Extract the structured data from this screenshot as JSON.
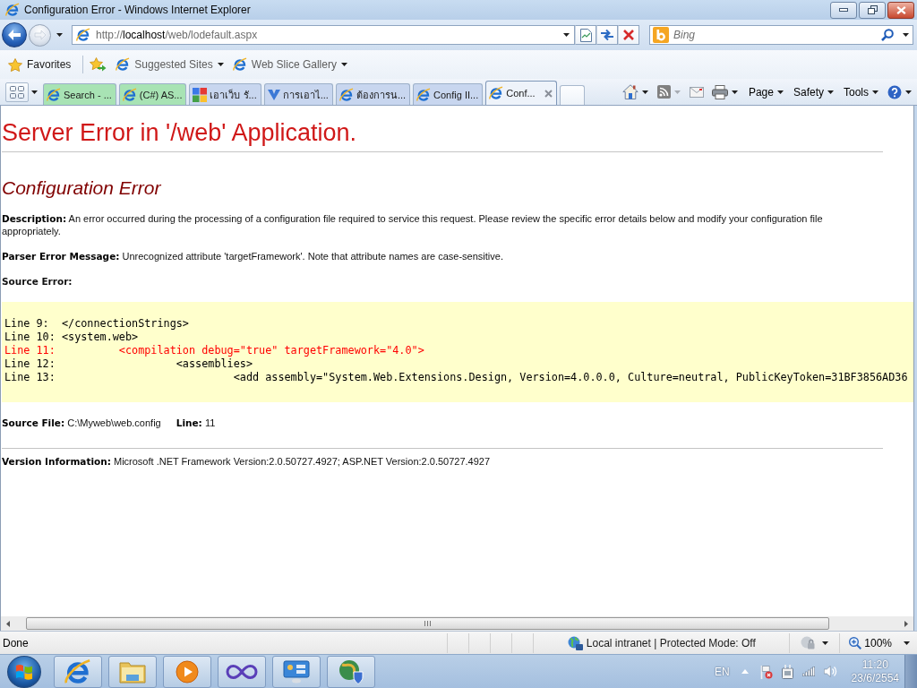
{
  "window": {
    "title": "Configuration Error - Windows Internet Explorer"
  },
  "nav_buttons": [
    {
      "kind": "back",
      "disabled": false
    },
    {
      "kind": "forward",
      "disabled": true
    }
  ],
  "address_bar": {
    "url": [
      {
        "text": "http://",
        "kind": "plain"
      },
      {
        "text": "localhost",
        "kind": "domain"
      },
      {
        "text": "/web/lodefault.aspx",
        "kind": "plain"
      }
    ]
  },
  "search_box": {
    "placeholder": "Bing"
  },
  "favorites_bar": {
    "favorites": "Favorites",
    "links": [
      {
        "label": "Suggested Sites"
      },
      {
        "label": "Web Slice Gallery"
      }
    ]
  },
  "tabs": [
    {
      "label": "Search - ...",
      "kind": "page",
      "selected": false,
      "color": "#a8e3b4"
    },
    {
      "label": "(C#) AS...",
      "kind": "page",
      "selected": false,
      "color": "#a8e3b4"
    },
    {
      "label": "เอาเว็บ รั...",
      "kind": "squares",
      "selected": false,
      "color": "#c8d6ef"
    },
    {
      "label": "การเอาไ...",
      "kind": "chevron",
      "selected": false,
      "color": "#c8d6ef"
    },
    {
      "label": "ต้องการน...",
      "kind": "page",
      "selected": false,
      "color": "#c8d6ef"
    },
    {
      "label": "Config II...",
      "kind": "page",
      "selected": false,
      "color": "#c8d6ef"
    },
    {
      "label": "Conf...",
      "kind": "page",
      "selected": true,
      "color": "#eef3fa"
    }
  ],
  "command_bar": {
    "feeds": {
      "disabled": true
    },
    "menus": [
      {
        "label": "Page"
      },
      {
        "label": "Safety"
      },
      {
        "label": "Tools"
      }
    ]
  },
  "page": {
    "heading": "Server Error in '/web' Application.",
    "error_title": "Configuration Error",
    "description": "**Description:** An error occurred during the processing of a configuration file required to service this request. Please review the specific error details below and modify your configuration file appropriately.",
    "parser_message": "**Parser Error Message:** Unrecognized attribute 'targetFramework'. Note that attribute names are case-sensitive.",
    "source_error_label": "Source Error:",
    "source_lines": [
      {
        "text": "Line 9:  </connectionStrings>",
        "highlighted": false
      },
      {
        "text": "Line 10: <system.web>",
        "highlighted": false
      },
      {
        "text": "Line 11:          <compilation debug=\"true\" targetFramework=\"4.0\">",
        "highlighted": true
      },
      {
        "text": "Line 12:                   <assemblies>",
        "highlighted": false
      },
      {
        "text": "Line 13:                            <add assembly=\"System.Web.Extensions.Design, Version=4.0.0.0, Culture=neutral, PublicKeyToken=31BF3856AD36",
        "highlighted": false
      }
    ],
    "source_file": "**Source File:** C:\\Myweb\\web.config",
    "source_line": "**Line:** 11",
    "version": "**Version Information:** Microsoft .NET Framework Version:2.0.50727.4927; ASP.NET Version:2.0.50727.4927"
  },
  "status_bar": {
    "text": "Done",
    "zone": "Local intranet | Protected Mode: Off",
    "zoom": "100%"
  },
  "taskbar": {
    "language": "EN",
    "time": "11:20",
    "date": "23/6/2554"
  }
}
